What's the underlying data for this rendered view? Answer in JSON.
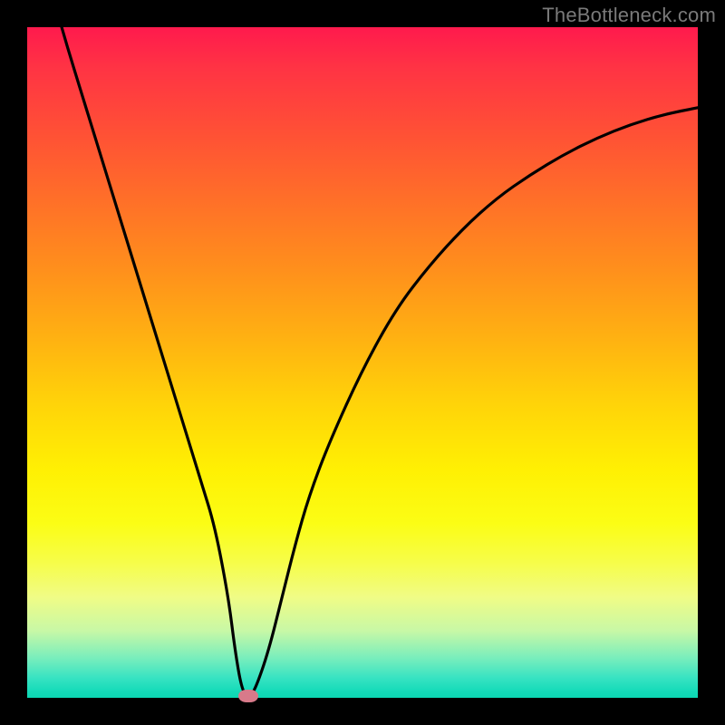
{
  "watermark": "TheBottleneck.com",
  "colors": {
    "background": "#000000",
    "gradient_top": "#ff1a4d",
    "gradient_bottom": "#0cd7b3",
    "curve": "#000000",
    "marker": "#d87a8a",
    "watermark": "#7a7a7a"
  },
  "chart_data": {
    "type": "line",
    "title": "",
    "xlabel": "",
    "ylabel": "",
    "xlim": [
      0,
      100
    ],
    "ylim": [
      0,
      100
    ],
    "grid": false,
    "watermark": "TheBottleneck.com",
    "series": [
      {
        "name": "bottleneck-curve",
        "x": [
          4,
          6,
          8,
          10,
          12,
          14,
          16,
          18,
          20,
          22,
          24,
          26,
          28,
          30,
          31,
          32,
          33,
          34,
          36,
          38,
          40,
          42,
          45,
          50,
          55,
          60,
          65,
          70,
          75,
          80,
          85,
          90,
          95,
          100
        ],
        "y": [
          104,
          97,
          90.5,
          84,
          77.5,
          71,
          64.5,
          58,
          51.5,
          45,
          38.5,
          32,
          25.5,
          15,
          7,
          1.2,
          0,
          1.2,
          7,
          15,
          23,
          30,
          38,
          49,
          58,
          64.5,
          70,
          74.5,
          78,
          81,
          83.5,
          85.5,
          87,
          88
        ]
      }
    ],
    "marker": {
      "x": 33,
      "y": 0
    },
    "notes": "V-shaped bottleneck curve on a red-to-green vertical gradient background; minimum (optimal match) near x≈33%. Values are estimated from pixel positions; the chart has no numeric axis labels."
  }
}
